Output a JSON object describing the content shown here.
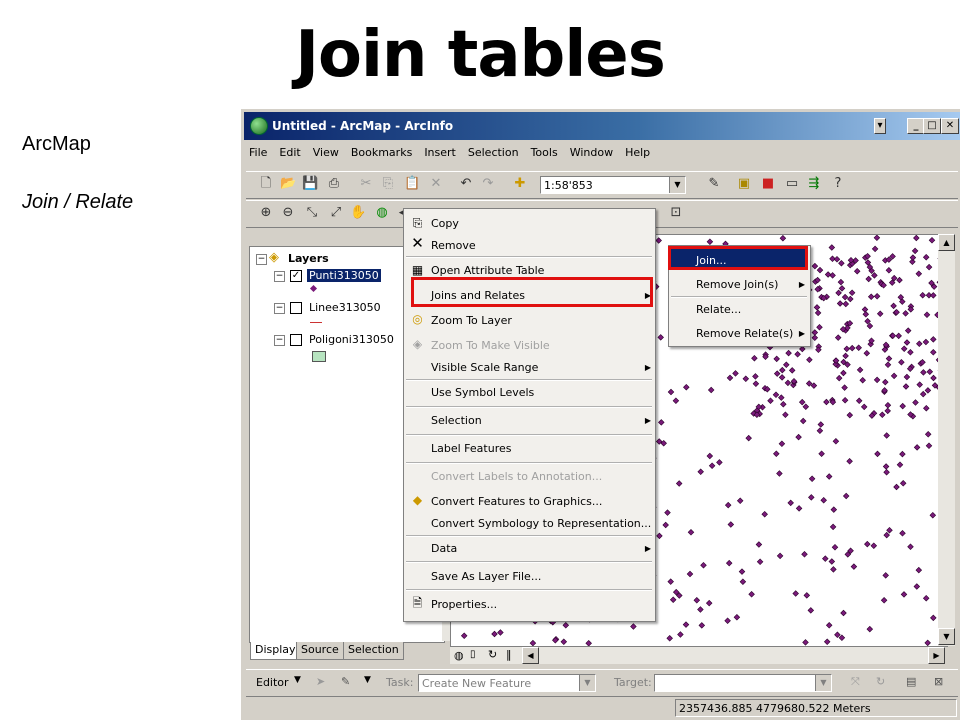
{
  "slide": {
    "title": "Join tables",
    "side_app": "ArcMap",
    "side_menu": "Join / Relate"
  },
  "window": {
    "title": "Untitled - ArcMap - ArcInfo"
  },
  "menubar": [
    "File",
    "Edit",
    "View",
    "Bookmarks",
    "Insert",
    "Selection",
    "Tools",
    "Window",
    "Help"
  ],
  "toolbar": {
    "scale": "1:58'853"
  },
  "toc": {
    "root": "Layers",
    "layers": [
      {
        "name": "Punti313050",
        "checked": true
      },
      {
        "name": "Linee313050",
        "checked": false
      },
      {
        "name": "Poligoni313050",
        "checked": false
      }
    ],
    "tabs": [
      "Display",
      "Source",
      "Selection"
    ]
  },
  "context_menu": {
    "items": [
      {
        "label": "Copy",
        "icon": "copy-icon"
      },
      {
        "label": "Remove",
        "icon": "x-icon"
      },
      {
        "label": "Open Attribute Table",
        "icon": "table-icon"
      },
      {
        "label": "Joins and Relates",
        "submenu": true
      },
      {
        "label": "Zoom To Layer",
        "icon": "zoom-icon"
      },
      {
        "label": "Zoom To Make Visible",
        "disabled": true
      },
      {
        "label": "Visible Scale Range",
        "submenu": true
      },
      {
        "label": "Use Symbol Levels"
      },
      {
        "label": "Selection",
        "submenu": true
      },
      {
        "label": "Label Features"
      },
      {
        "label": "Convert Labels to Annotation...",
        "disabled": true
      },
      {
        "label": "Convert Features to Graphics...",
        "icon": "convert-icon"
      },
      {
        "label": "Convert Symbology to Representation..."
      },
      {
        "label": "Data",
        "submenu": true
      },
      {
        "label": "Save As Layer File..."
      },
      {
        "label": "Properties...",
        "icon": "properties-icon"
      }
    ]
  },
  "submenu": {
    "items": [
      {
        "label": "Join...",
        "highlighted": true
      },
      {
        "label": "Remove Join(s)",
        "submenu": true
      },
      {
        "label": "Relate..."
      },
      {
        "label": "Remove Relate(s)",
        "submenu": true
      }
    ]
  },
  "editor": {
    "label": "Editor",
    "task_label": "Task:",
    "task_value": "Create New Feature",
    "target_label": "Target:"
  },
  "status": {
    "coords": "2357436.885  4779680.522 Meters"
  },
  "colors": {
    "point": "#7a1a7a",
    "titlebar": "#0a246a",
    "highlight": "#e01010"
  }
}
